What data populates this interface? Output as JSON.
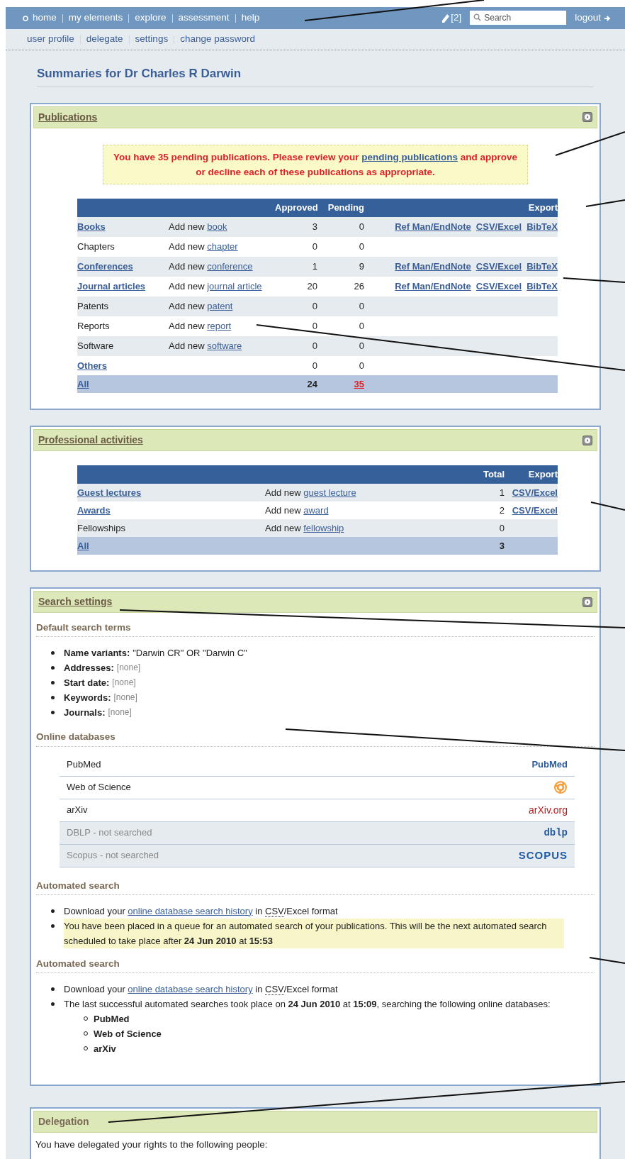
{
  "nav": {
    "items": [
      "home",
      "my elements",
      "explore",
      "assessment",
      "help"
    ],
    "badge": "[2]",
    "search": {
      "placeholder": "Search"
    },
    "logout": "logout"
  },
  "subnav": [
    "user profile",
    "delegate",
    "settings",
    "change password"
  ],
  "heading": "Summaries for Dr Charles R Darwin",
  "publications": {
    "title": "Publications",
    "alert": {
      "before": "You have 35 pending publications. Please review your ",
      "link": "pending publications",
      "after": " and approve or decline each of these publications as appropriate."
    },
    "columns": [
      "Approved",
      "Pending",
      "Export"
    ],
    "rows": [
      {
        "name": "Books",
        "linked": true,
        "add": "Add new",
        "add_link": "book",
        "approved": "3",
        "pending": "0",
        "exports": [
          "Ref Man/EndNote",
          "CSV/Excel",
          "BibTeX"
        ]
      },
      {
        "name": "Chapters",
        "linked": false,
        "add": "Add new",
        "add_link": "chapter",
        "approved": "0",
        "pending": "0",
        "exports": []
      },
      {
        "name": "Conferences",
        "linked": true,
        "add": "Add new",
        "add_link": "conference",
        "approved": "1",
        "pending": "9",
        "exports": [
          "Ref Man/EndNote",
          "CSV/Excel",
          "BibTeX"
        ]
      },
      {
        "name": "Journal articles",
        "linked": true,
        "add": "Add new",
        "add_link": "journal article",
        "approved": "20",
        "pending": "26",
        "exports": [
          "Ref Man/EndNote",
          "CSV/Excel",
          "BibTeX"
        ]
      },
      {
        "name": "Patents",
        "linked": false,
        "add": "Add new",
        "add_link": "patent",
        "approved": "0",
        "pending": "0",
        "exports": []
      },
      {
        "name": "Reports",
        "linked": false,
        "add": "Add new",
        "add_link": "report",
        "approved": "0",
        "pending": "0",
        "exports": []
      },
      {
        "name": "Software",
        "linked": false,
        "add": "Add new",
        "add_link": "software",
        "approved": "0",
        "pending": "0",
        "exports": []
      },
      {
        "name": "Others",
        "linked": true,
        "approved": "0",
        "pending": "0",
        "exports": []
      }
    ],
    "total": {
      "name": "All",
      "approved": "24",
      "pending": "35"
    }
  },
  "activities": {
    "title": "Professional activities",
    "columns": [
      "Total",
      "Export"
    ],
    "rows": [
      {
        "name": "Guest lectures",
        "linked": true,
        "add": "Add new",
        "add_link": "guest lecture",
        "total": "1",
        "exports": [
          "CSV/Excel"
        ]
      },
      {
        "name": "Awards",
        "linked": true,
        "add": "Add new",
        "add_link": "award",
        "total": "2",
        "exports": [
          "CSV/Excel"
        ]
      },
      {
        "name": "Fellowships",
        "linked": false,
        "add": "Add new",
        "add_link": "fellowship",
        "total": "0",
        "exports": []
      }
    ],
    "total": {
      "name": "All",
      "total": "3"
    }
  },
  "search_settings": {
    "title": "Search settings",
    "terms": {
      "heading": "Default search terms",
      "items": [
        {
          "label": "Name variants:",
          "value": "\"Darwin CR\" OR \"Darwin C\"",
          "muted": false
        },
        {
          "label": "Addresses:",
          "value": "[none]",
          "muted": true
        },
        {
          "label": "Start date:",
          "value": "[none]",
          "muted": true
        },
        {
          "label": "Keywords:",
          "value": "[none]",
          "muted": true
        },
        {
          "label": "Journals:",
          "value": "[none]",
          "muted": true
        }
      ]
    },
    "databases": {
      "heading": "Online databases",
      "items": [
        {
          "name": "PubMed",
          "searched": true,
          "kind": "pubmed",
          "logo": "PubMed"
        },
        {
          "name": "Web of Science",
          "searched": true,
          "kind": "wos"
        },
        {
          "name": "arXiv",
          "searched": true,
          "kind": "arxiv",
          "logo": "arXiv.org"
        },
        {
          "name": "DBLP - not searched",
          "searched": false,
          "kind": "dblp",
          "logo": "dblp"
        },
        {
          "name": "Scopus - not searched",
          "searched": false,
          "kind": "scopus",
          "logo": "SCOPUS"
        }
      ]
    },
    "automated": [
      {
        "heading": "Automated search",
        "items": [
          {
            "kind": "download",
            "before": "Download your ",
            "link": "online database search history",
            "middle": " in ",
            "abbr": "CSV",
            "after": "/Excel format"
          },
          {
            "kind": "note",
            "highlighted": true,
            "text": "You have been placed in a queue for an automated search of your publications. This will be the next automated search scheduled to take place after **24 Jun 2010** at **15:53**"
          }
        ]
      },
      {
        "heading": "Automated search",
        "items": [
          {
            "kind": "download",
            "before": "Download your ",
            "link": "online database search history",
            "middle": " in ",
            "abbr": "CSV",
            "after": "/Excel format"
          },
          {
            "kind": "note",
            "highlighted": false,
            "text": "The last successful automated searches took place on **24 Jun 2010** at **15:09**, searching the following online databases:",
            "children": [
              "PubMed",
              "Web of Science",
              "arXiv"
            ]
          }
        ]
      }
    ]
  },
  "delegation": {
    "title": "Delegation",
    "text": "You have delegated your rights to the following people:"
  }
}
